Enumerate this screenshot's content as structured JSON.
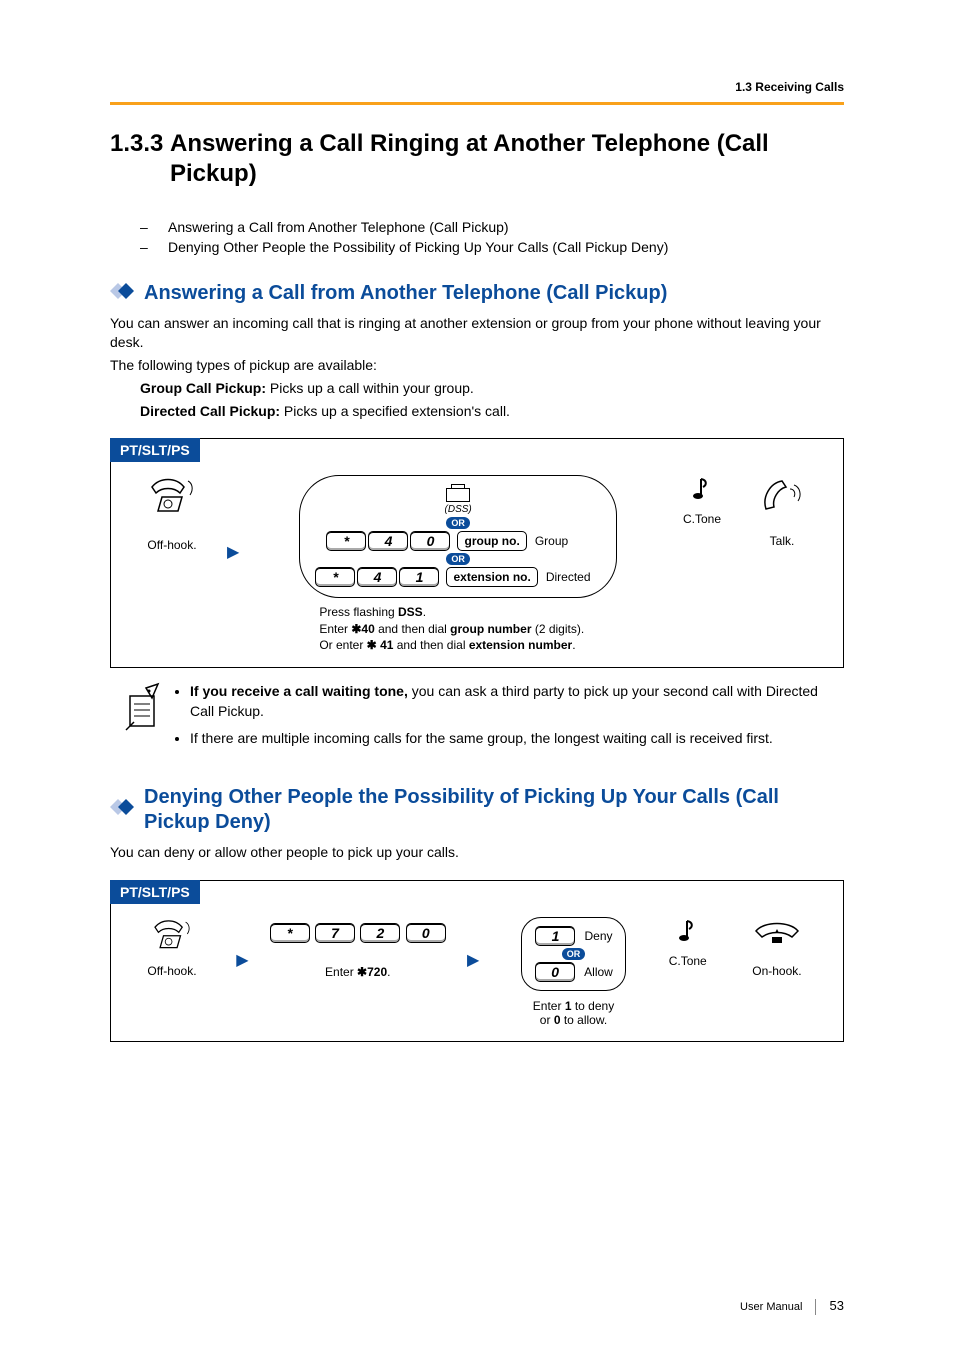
{
  "running_head": "1.3 Receiving Calls",
  "section": {
    "number": "1.3.3",
    "title": "Answering a Call Ringing at Another Telephone (Call Pickup)"
  },
  "toc": [
    "Answering a Call from Another Telephone (Call Pickup)",
    "Denying Other People the Possibility of Picking Up Your Calls (Call Pickup Deny)"
  ],
  "sub1": {
    "heading": "Answering a Call from Another Telephone (Call Pickup)",
    "para1": "You can answer an incoming call that is ringing at another extension or group from your phone without leaving your desk.",
    "para2": "The following types of pickup are available:",
    "def1_label": "Group Call Pickup:",
    "def1_text": " Picks up a call within your group.",
    "def2_label": "Directed Call Pickup:",
    "def2_text": " Picks up a specified extension's call."
  },
  "diagram1": {
    "tab": "PT/SLT/PS",
    "offhook": "Off-hook.",
    "dss_label": "(DSS)",
    "or": "OR",
    "keys_group": [
      "*",
      "4",
      "0"
    ],
    "field_group": "group no.",
    "group_lbl": "Group",
    "keys_dir": [
      "*",
      "4",
      "1"
    ],
    "field_dir": "extension no.",
    "dir_lbl": "Directed",
    "ctone": "C.Tone",
    "talk": "Talk.",
    "cap_line1_a": "Press flashing ",
    "cap_line1_b": "DSS",
    "cap_line1_c": ".",
    "cap_line2_a": "Enter ",
    "cap_line2_b": "40",
    "cap_line2_c": " and then dial ",
    "cap_line2_d": "group number",
    "cap_line2_e": " (2 digits).",
    "cap_line3_a": "Or enter ",
    "cap_line3_b": "41",
    "cap_line3_c": " and then dial ",
    "cap_line3_d": "extension number",
    "cap_line3_e": "."
  },
  "notes": {
    "n1_a": "If you receive a call waiting tone,",
    "n1_b": " you can ask a third party to pick up your second call with Directed Call Pickup.",
    "n2": "If there are multiple incoming calls for the same group, the longest waiting call is received first."
  },
  "sub2": {
    "heading": "Denying Other People the Possibility of Picking Up Your Calls (Call Pickup Deny)",
    "para": "You can deny or allow other people to pick up your calls."
  },
  "diagram2": {
    "tab": "PT/SLT/PS",
    "offhook": "Off-hook.",
    "keys": [
      "*",
      "7",
      "2",
      "0"
    ],
    "enter_a": "Enter ",
    "enter_b": "720",
    "enter_c": ".",
    "deny_key": "1",
    "deny_lbl": "Deny",
    "or": "OR",
    "allow_key": "0",
    "allow_lbl": "Allow",
    "choose_a": "Enter ",
    "choose_b": "1",
    "choose_c": " to deny",
    "choose_d": "or ",
    "choose_e": "0",
    "choose_f": " to allow.",
    "ctone": "C.Tone",
    "onhook": "On-hook."
  },
  "footer": {
    "label": "User Manual",
    "page": "53"
  }
}
